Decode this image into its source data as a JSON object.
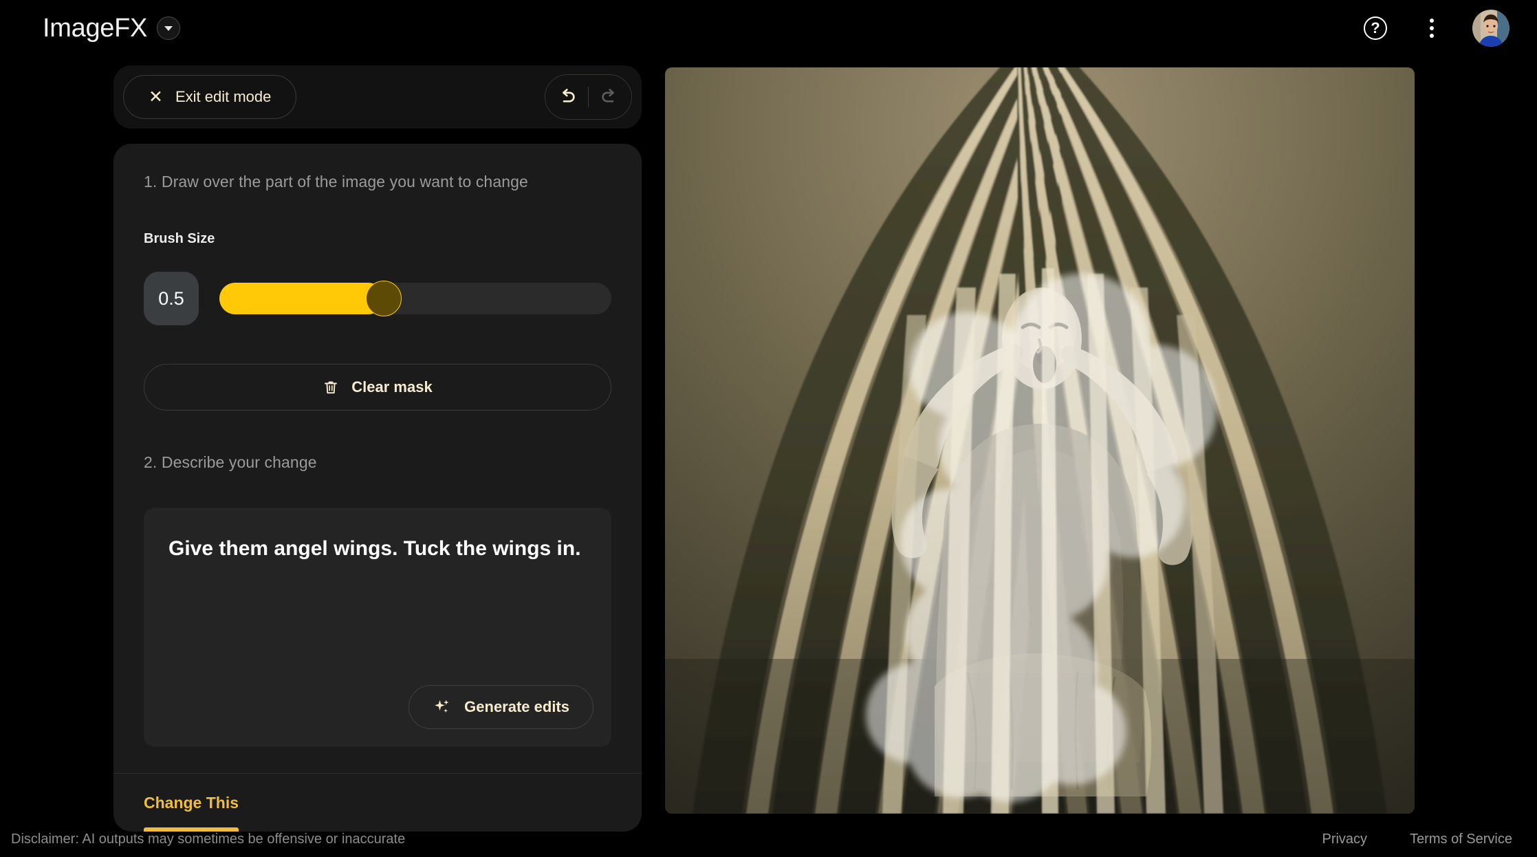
{
  "app": {
    "title": "ImageFX",
    "brand_caret_icon": "chevron-down-icon"
  },
  "topbar": {
    "help_icon": "help-circle-icon",
    "help_glyph": "?",
    "more_icon": "more-vertical-icon",
    "avatar_icon": "user-avatar"
  },
  "toolbar": {
    "exit_label": "Exit edit mode",
    "exit_icon": "close-x-icon",
    "undo_icon": "undo-icon",
    "redo_icon": "redo-icon",
    "undo_enabled": "true",
    "redo_enabled": "false"
  },
  "edit_panel": {
    "step1_label": "1. Draw over the part of the image you want to change",
    "brush_size_label": "Brush Size",
    "brush_size_value": "0.5",
    "brush_slider": {
      "min": "0",
      "max": "1",
      "value": "0.5",
      "fill_percent": 42,
      "fill_color": "#FFC907",
      "track_color": "#2b2b2b",
      "thumb_color": "#5d4a05"
    },
    "clear_mask_label": "Clear mask",
    "clear_mask_icon": "trash-icon",
    "step2_label": "2. Describe your change",
    "prompt_value": "Give them angel wings. Tuck the wings in.",
    "prompt_placeholder": "Describe your change",
    "generate_label": "Generate edits",
    "generate_icon": "sparkle-icon",
    "tabs": [
      {
        "label": "Change This",
        "active": "true"
      }
    ]
  },
  "canvas": {
    "alt": "Sepia painting of a screaming figure with hands on head behind radial striped bars, with a translucent white brush mask drawn over the figure",
    "mask_color": "#ffffff",
    "mask_opacity": "0.55"
  },
  "footer": {
    "disclaimer": "Disclaimer: AI outputs may sometimes be offensive or inaccurate",
    "links": [
      {
        "label": "Privacy"
      },
      {
        "label": "Terms of Service"
      }
    ]
  },
  "colors": {
    "accent_yellow": "#FFC907",
    "tab_gold": "#F0BE3C",
    "cream_text": "#f7ecd0",
    "panel_bg": "#1b1b1b",
    "page_bg": "#000000"
  }
}
